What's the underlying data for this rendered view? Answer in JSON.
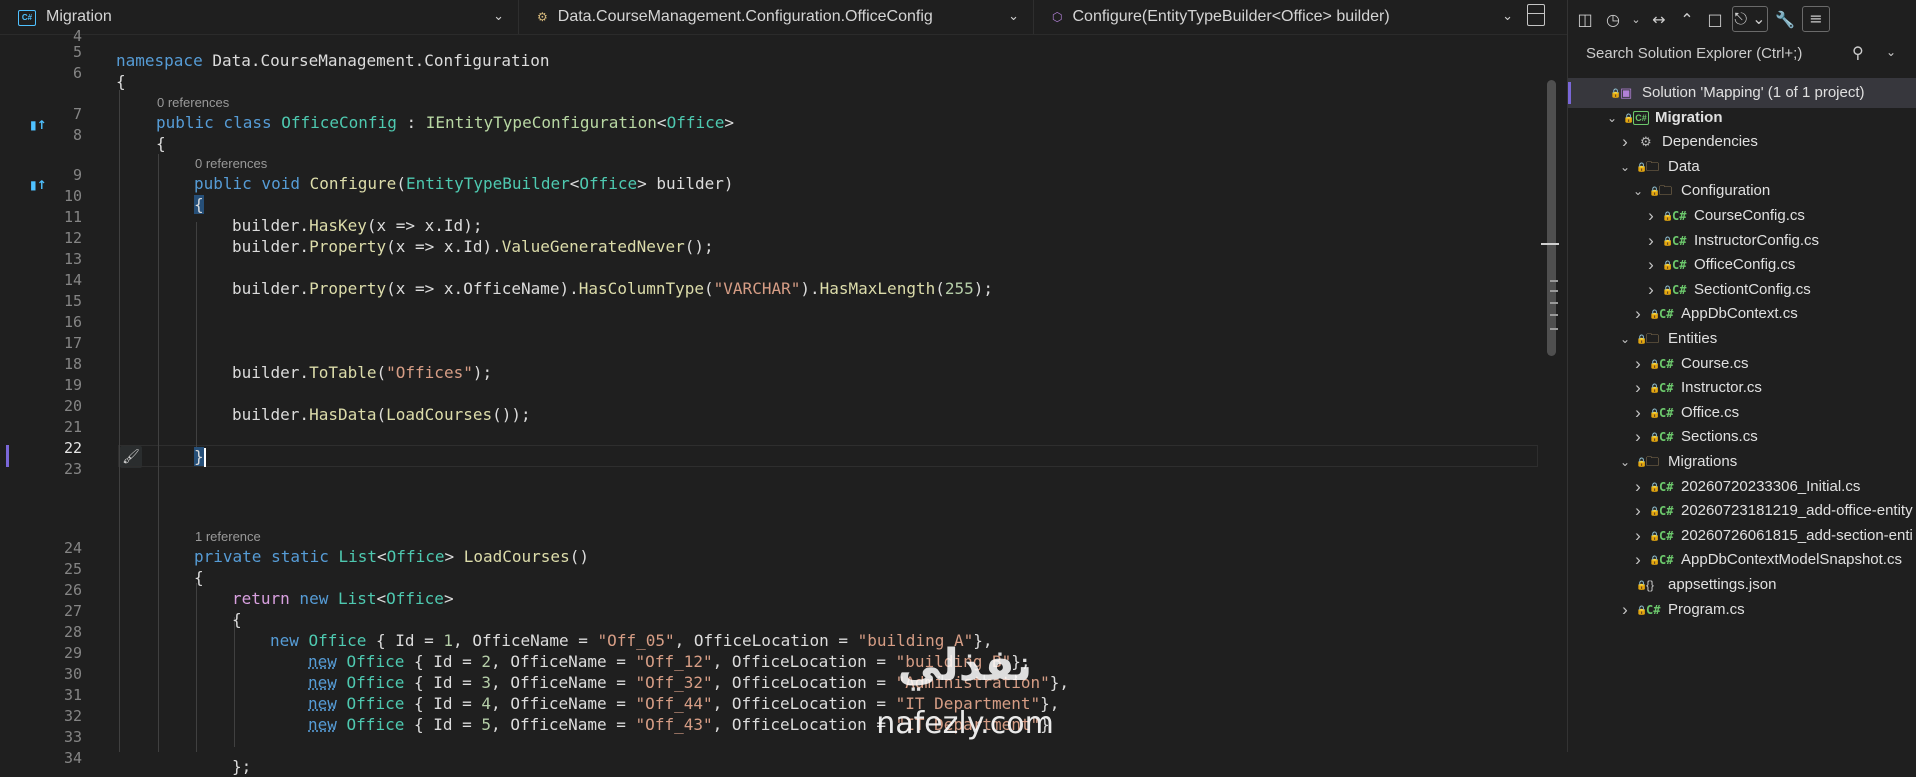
{
  "navbar": {
    "project": "Migration",
    "type": "Data.CourseManagement.Configuration.OfficeConfig",
    "member": "Configure(EntityTypeBuilder<Office> builder)"
  },
  "line_numbers": [
    "4",
    "5",
    "6",
    "7",
    "8",
    "9",
    "10",
    "11",
    "12",
    "13",
    "14",
    "15",
    "16",
    "17",
    "18",
    "19",
    "20",
    "21",
    "22",
    "23",
    "24",
    "25",
    "26",
    "27",
    "28",
    "29",
    "30",
    "31",
    "32",
    "33",
    "34"
  ],
  "active_line": "22",
  "codelens": {
    "class_refs": "0 references",
    "method_refs": "0 references",
    "loadcourses_refs": "1 reference"
  },
  "code": {
    "l5_kw": "namespace",
    "l5_name": " Data.CourseManagement.Configuration",
    "l6": "{",
    "l7_kw": "public class",
    "l7_cls": "OfficeConfig",
    "l7_colon": " : ",
    "l7_iface": "IEntityTypeConfiguration",
    "l7_lt": "<",
    "l7_arg": "Office",
    "l7_gt": ">",
    "l8": "{",
    "l9_kw": "public void",
    "l9_meth": "Configure",
    "l9_p1": "(",
    "l9_cls": "EntityTypeBuilder",
    "l9_lt": "<",
    "l9_arg": "Office",
    "l9_p2": "> builder)",
    "l10": "{",
    "l11_a": "builder.",
    "l11_m": "HasKey",
    "l11_b": "(x => x.Id);",
    "l12_a": "builder.",
    "l12_m": "Property",
    "l12_b": "(x => x.Id).",
    "l12_m2": "ValueGeneratedNever",
    "l12_c": "();",
    "l14_a": "builder.",
    "l14_m": "Property",
    "l14_b": "(x => x.OfficeName).",
    "l14_m2": "HasColumnType",
    "l14_c": "(",
    "l14_s": "\"VARCHAR\"",
    "l14_d": ").",
    "l14_m3": "HasMaxLength",
    "l14_e": "(",
    "l14_n": "255",
    "l14_f": ");",
    "l18_a": "builder.",
    "l18_m": "ToTable",
    "l18_b": "(",
    "l18_s": "\"Offices\"",
    "l18_c": ");",
    "l20_a": "builder.",
    "l20_m": "HasData",
    "l20_b": "(",
    "l20_m2": "LoadCourses",
    "l20_c": "());",
    "l22": "}",
    "l24_kw": "private static",
    "l24_cls": "List",
    "l24_lt": "<",
    "l24_arg": "Office",
    "l24_gt": "> ",
    "l24_meth": "LoadCourses",
    "l24_p": "()",
    "l25": "{",
    "l26_kw": "return",
    "l26_kw2": " new ",
    "l26_cls": "List",
    "l26_lt": "<",
    "l26_arg": "Office",
    "l26_gt": ">",
    "l27": "{",
    "rows": [
      {
        "kw": "new",
        "cls": " Office",
        "a": " { Id = ",
        "id": "1",
        "b": ", OfficeName = ",
        "name": "\"Off_05\"",
        "c": ", OfficeLocation = ",
        "loc": "\"building A\"",
        "d": "},"
      },
      {
        "kw": "new",
        "cls": " Office",
        "a": " { Id = ",
        "id": "2",
        "b": ", OfficeName = ",
        "name": "\"Off_12\"",
        "c": ", OfficeLocation = ",
        "loc": "\"building B\"",
        "d": "},"
      },
      {
        "kw": "new",
        "cls": " Office",
        "a": " { Id = ",
        "id": "3",
        "b": ", OfficeName = ",
        "name": "\"Off_32\"",
        "c": ", OfficeLocation = ",
        "loc": "\"Administration\"",
        "d": "},"
      },
      {
        "kw": "new",
        "cls": " Office",
        "a": " { Id = ",
        "id": "4",
        "b": ", OfficeName = ",
        "name": "\"Off_44\"",
        "c": ", OfficeLocation = ",
        "loc": "\"IT Department\"",
        "d": "},"
      },
      {
        "kw": "new",
        "cls": " Office",
        "a": " { Id = ",
        "id": "5",
        "b": ", OfficeName = ",
        "name": "\"Off_43\"",
        "c": ", OfficeLocation = ",
        "loc": "\"IT Department\"",
        "d": "}"
      }
    ],
    "l34": "};"
  },
  "explorer": {
    "search_placeholder": "Search Solution Explorer (Ctrl+;)",
    "tree": [
      {
        "label": "Solution 'Mapping' (1 of 1 project)",
        "kind": "solution",
        "depth": 0,
        "chev": "",
        "selected": true
      },
      {
        "label": "Migration",
        "kind": "project",
        "depth": 1,
        "chev": "v",
        "bold": true
      },
      {
        "label": "Dependencies",
        "kind": "deps",
        "depth": 2,
        "chev": ">"
      },
      {
        "label": "Data",
        "kind": "folder",
        "depth": 2,
        "chev": "v"
      },
      {
        "label": "Configuration",
        "kind": "folder",
        "depth": 3,
        "chev": "v"
      },
      {
        "label": "CourseConfig.cs",
        "kind": "cs",
        "depth": 4,
        "chev": ">"
      },
      {
        "label": "InstructorConfig.cs",
        "kind": "cs",
        "depth": 4,
        "chev": ">"
      },
      {
        "label": "OfficeConfig.cs",
        "kind": "cs",
        "depth": 4,
        "chev": ">"
      },
      {
        "label": "SectiontConfig.cs",
        "kind": "cs",
        "depth": 4,
        "chev": ">"
      },
      {
        "label": "AppDbContext.cs",
        "kind": "cs",
        "depth": 3,
        "chev": ">"
      },
      {
        "label": "Entities",
        "kind": "folder",
        "depth": 2,
        "chev": "v"
      },
      {
        "label": "Course.cs",
        "kind": "cs",
        "depth": 3,
        "chev": ">"
      },
      {
        "label": "Instructor.cs",
        "kind": "cs",
        "depth": 3,
        "chev": ">"
      },
      {
        "label": "Office.cs",
        "kind": "cs",
        "depth": 3,
        "chev": ">"
      },
      {
        "label": "Sections.cs",
        "kind": "cs",
        "depth": 3,
        "chev": ">"
      },
      {
        "label": "Migrations",
        "kind": "folder",
        "depth": 2,
        "chev": "v"
      },
      {
        "label": "20260720233306_Initial.cs",
        "kind": "cs",
        "depth": 3,
        "chev": ">"
      },
      {
        "label": "20260723181219_add-office-entity",
        "kind": "cs",
        "depth": 3,
        "chev": ">"
      },
      {
        "label": "20260726061815_add-section-enti",
        "kind": "cs",
        "depth": 3,
        "chev": ">"
      },
      {
        "label": "AppDbContextModelSnapshot.cs",
        "kind": "cs",
        "depth": 3,
        "chev": ">"
      },
      {
        "label": "appsettings.json",
        "kind": "json",
        "depth": 2,
        "chev": ""
      },
      {
        "label": "Program.cs",
        "kind": "cs",
        "depth": 2,
        "chev": ">"
      }
    ]
  },
  "watermark": {
    "arabic": "نفذلي",
    "latin": "nafezly.com"
  }
}
